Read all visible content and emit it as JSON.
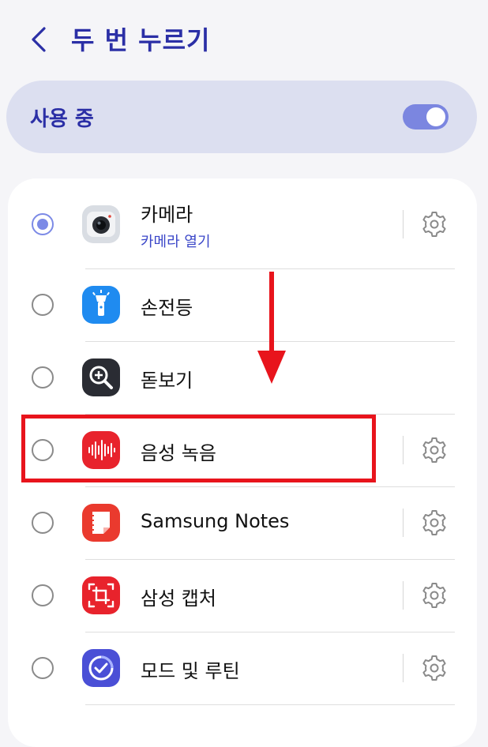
{
  "header": {
    "title": "두 번 누르기",
    "back_icon": "chevron-left-icon"
  },
  "master": {
    "label": "사용 중",
    "enabled": true,
    "accent": "#7b86e0"
  },
  "colors": {
    "title": "#2b2fa6",
    "subtitle": "#3a46c8",
    "annotation": "#e8141c",
    "card_bg": "#ffffff",
    "page_bg": "#f5f5f8"
  },
  "items": [
    {
      "title": "카메라",
      "subtitle": "카메라 열기",
      "selected": true,
      "icon": "camera-icon",
      "has_settings": true
    },
    {
      "title": "손전등",
      "selected": false,
      "icon": "flashlight-icon",
      "has_settings": false
    },
    {
      "title": "돋보기",
      "selected": false,
      "icon": "magnifier-icon",
      "has_settings": false
    },
    {
      "title": "음성 녹음",
      "selected": false,
      "icon": "voice-recorder-icon",
      "has_settings": true
    },
    {
      "title": "Samsung Notes",
      "selected": false,
      "icon": "samsung-notes-icon",
      "has_settings": true
    },
    {
      "title": "삼성 캡처",
      "selected": false,
      "icon": "samsung-capture-icon",
      "has_settings": true
    },
    {
      "title": "모드 및 루틴",
      "selected": false,
      "icon": "modes-routines-icon",
      "has_settings": true
    }
  ],
  "annotations": {
    "arrow": "down-arrow-annotation",
    "highlight_target": "음성 녹음"
  }
}
